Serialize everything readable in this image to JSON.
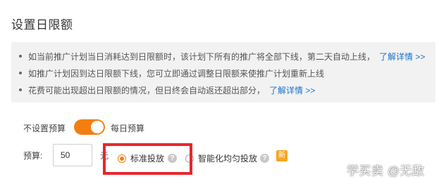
{
  "page_title": "设置日限额",
  "notice": {
    "items": [
      {
        "text": "如当前推广计划当日消耗达到日限额时，该计划下所有的推广将全部下线，第二天自动上线，",
        "link": "了解详情 >>"
      },
      {
        "text": "如推广计划因到达日限额下线，您可立即通过调整日限额来使推广计划重新上线",
        "link": ""
      },
      {
        "text": "花费可能出现超出日限额的情况，但日终会自动返还超出部分，",
        "link": "了解详情 >>"
      }
    ]
  },
  "budget_toggle": {
    "left_label": "不设置预算",
    "right_label": "每日预算",
    "state": "on",
    "color": "#f57e12"
  },
  "budget": {
    "label": "预算:",
    "value": "50",
    "unit": "元"
  },
  "delivery_options": [
    {
      "label": "标准投放",
      "checked": true
    },
    {
      "label": "智能化均匀投放",
      "checked": false
    }
  ],
  "help_icon": "?",
  "new_badge": "新",
  "watermark": "学买卖 @无敌",
  "colors": {
    "accent": "#f57e12",
    "link": "#1a73c8",
    "highlight_box": "#e8262d"
  }
}
